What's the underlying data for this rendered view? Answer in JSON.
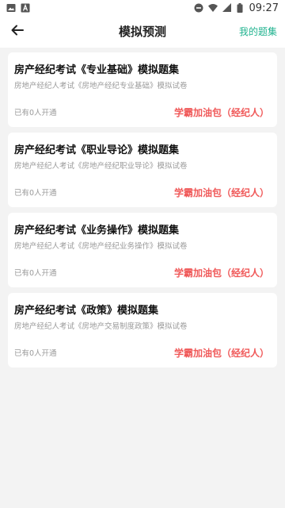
{
  "status_bar": {
    "time": "09:27",
    "left_icons": [
      "image-icon",
      "a-letter-icon"
    ],
    "right_icons": [
      "do-not-disturb-icon",
      "wifi-icon",
      "signal-icon",
      "battery-icon"
    ]
  },
  "header": {
    "title": "模拟预测",
    "right_link": "我的题集"
  },
  "colors": {
    "accent": "#21b38f",
    "tag": "#f05a5a",
    "background": "#f3f3f3"
  },
  "cards": [
    {
      "title": "房产经纪考试《专业基础》模拟题集",
      "subtitle": "房地产经纪人考试《房地产经纪专业基础》模拟试卷",
      "count": "已有0人开通",
      "tag": "学霸加油包（经纪人）"
    },
    {
      "title": "房产经纪考试《职业导论》模拟题集",
      "subtitle": "房地产经纪人考试《房地产经纪职业导论》模拟试卷",
      "count": "已有0人开通",
      "tag": "学霸加油包（经纪人）"
    },
    {
      "title": "房产经纪考试《业务操作》模拟题集",
      "subtitle": "房地产经纪人考试《房地产经纪业务操作》模拟试卷",
      "count": "已有0人开通",
      "tag": "学霸加油包（经纪人）"
    },
    {
      "title": "房产经纪考试《政策》模拟题集",
      "subtitle": "房地产经纪人考试《房地产交易制度政策》模拟试卷",
      "count": "已有0人开通",
      "tag": "学霸加油包（经纪人）"
    }
  ]
}
